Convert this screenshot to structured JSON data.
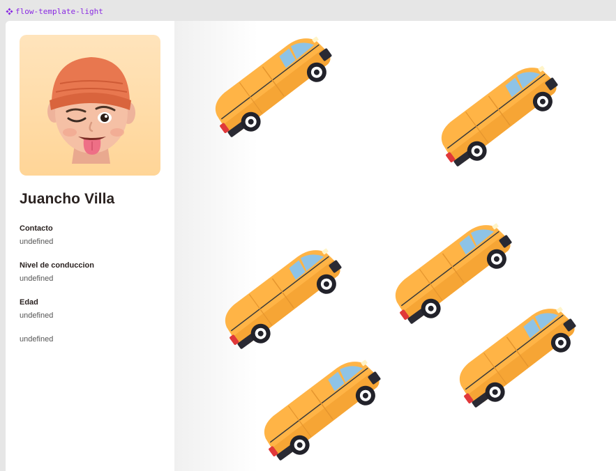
{
  "window": {
    "label": "flow-template-light",
    "icon": "component-icon",
    "accent": "#8a2be2"
  },
  "profile": {
    "name": "Juancho Villa",
    "avatar": "memoji-avatar",
    "fields": [
      {
        "label": "Contacto",
        "value": "undefined"
      },
      {
        "label": "Nivel de conduccion",
        "value": "undefined"
      },
      {
        "label": "Edad",
        "value": "undefined"
      },
      {
        "label": "",
        "value": "undefined"
      }
    ]
  },
  "vehicles": {
    "icon": "yellow-van-icon",
    "count": 6,
    "color": "#ffb446"
  }
}
